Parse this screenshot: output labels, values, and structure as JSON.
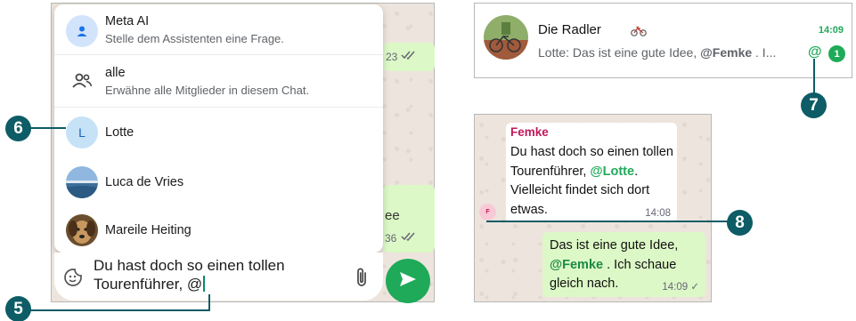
{
  "left": {
    "menu": {
      "meta_ai": {
        "title": "Meta AI",
        "subtitle": "Stelle dem Assistenten eine Frage."
      },
      "all": {
        "title": "alle",
        "subtitle": "Erwähne alle Mitglieder in diesem Chat."
      },
      "contacts": [
        {
          "name": "Lotte",
          "initial": "L"
        },
        {
          "name": "Luca de Vries"
        },
        {
          "name": "Mareile Heiting"
        }
      ]
    },
    "peek": {
      "time1": "23",
      "text2": "ee",
      "time2": "36"
    },
    "composer": {
      "text_line1": "Du hast doch so einen tollen",
      "text_line2": "Tourenführer, @"
    }
  },
  "chat_list": {
    "group_name": "Die Radler",
    "last_message_prefix": "Lotte: Das ist eine gute Idee, ",
    "last_message_mention": "@Femke",
    "last_message_suffix": " . I...",
    "time": "14:09",
    "mention_symbol": "@",
    "unread_count": "1"
  },
  "chat": {
    "incoming": {
      "sender": "Femke",
      "text_before": "Du hast doch so einen tollen Tourenführer, ",
      "mention": "@Lotte",
      "text_after": ". Vielleicht findet sich dort etwas.",
      "time": "14:08",
      "avatar_initial": "F"
    },
    "outgoing": {
      "text_before": "Das ist eine gute Idee, ",
      "mention": "@Femke",
      "text_after": " . Ich schaue gleich nach.",
      "time": "14:09 ✓"
    }
  },
  "callouts": {
    "c5": "5",
    "c6": "6",
    "c7": "7",
    "c8": "8"
  },
  "colors": {
    "accent": "#1faa59",
    "callout": "#0d5c66",
    "sender": "#c2185b",
    "wallpaper": "#ede5dd",
    "outgoing_bubble": "#dcf8c6"
  }
}
